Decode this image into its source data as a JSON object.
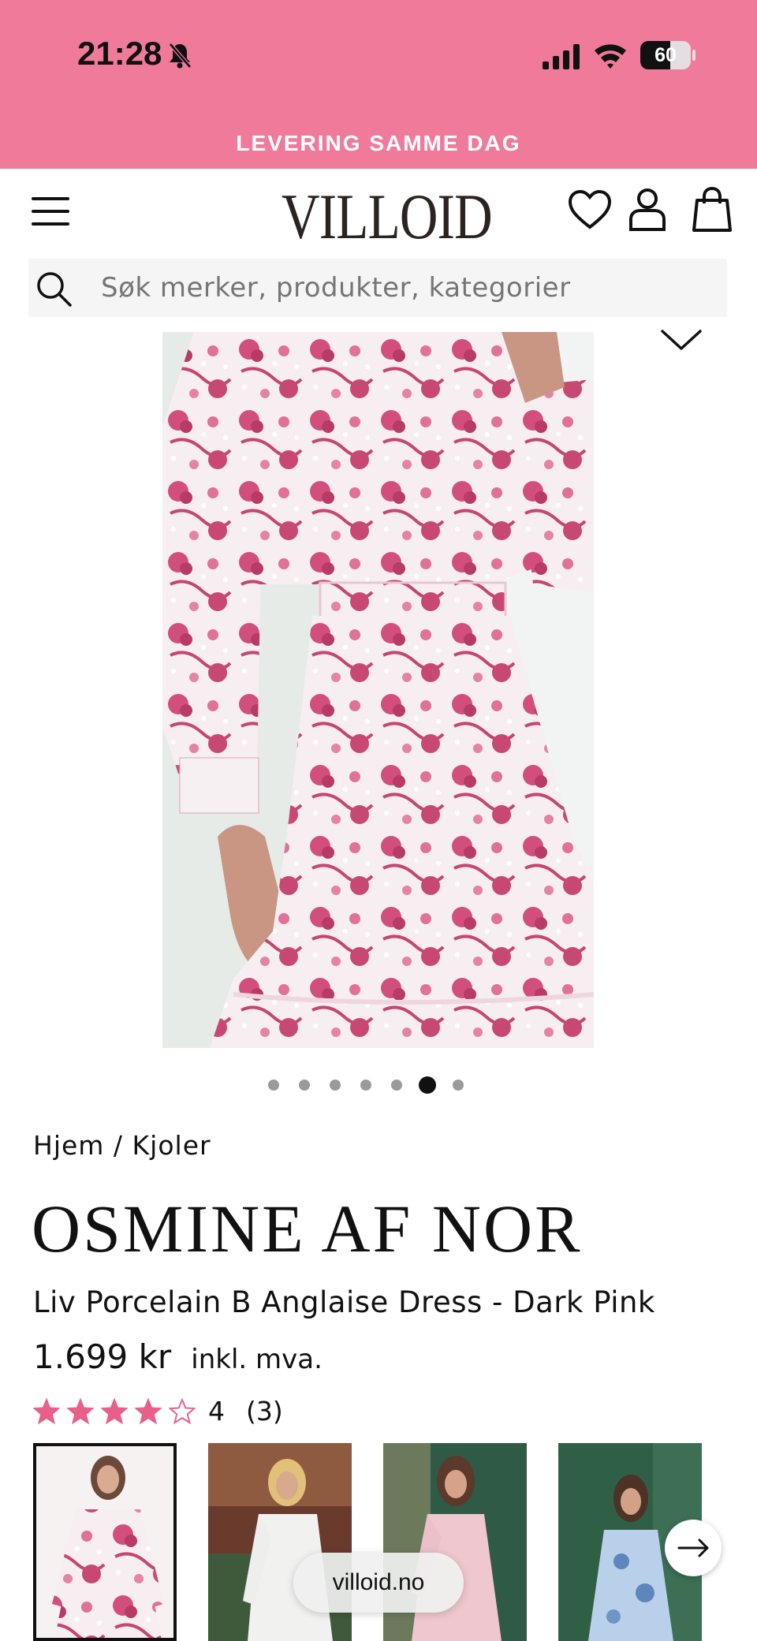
{
  "status_bar": {
    "time": "21:28",
    "battery": "60",
    "battery_level": 0.6
  },
  "promo": {
    "text": "LEVERING SAMME DAG"
  },
  "header": {
    "logo": "VILLOID",
    "icons": [
      "menu-icon",
      "heart-icon",
      "user-icon",
      "bag-icon"
    ]
  },
  "search": {
    "placeholder": "Søk merker, produkter, kategorier"
  },
  "gallery": {
    "slide_count": 7,
    "active_slide": 6
  },
  "breadcrumb": {
    "text": "Hjem / Kjoler"
  },
  "product": {
    "brand": "OSMINE AF NOR",
    "name": "Liv Porcelain B Anglaise Dress - Dark Pink",
    "price": "1.699 kr",
    "vat_note": "inkl. mva.",
    "rating_value": "4",
    "rating_count": "(3)",
    "stars_filled": 4,
    "stars_total": 5
  },
  "colors": {
    "brand_pink": "#f07a9a",
    "star_pink": "#e8608a"
  },
  "browser": {
    "url": "villoid.no"
  }
}
